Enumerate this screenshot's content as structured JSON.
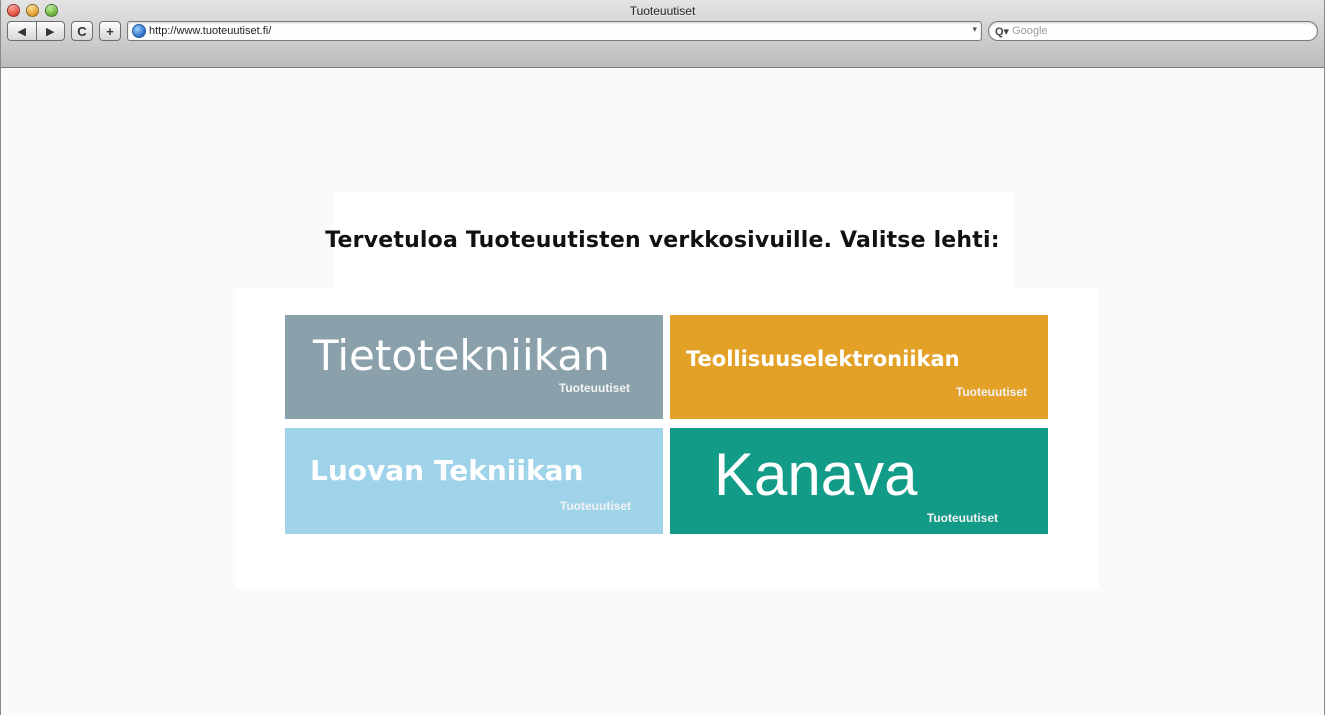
{
  "window": {
    "title": "Tuoteuutiset"
  },
  "toolbar": {
    "back_icon": "◀",
    "forward_icon": "▶",
    "reload_icon": "C",
    "add_icon": "+",
    "url": "http://www.tuoteuutiset.fi/",
    "search_placeholder": "Google",
    "search_icon": "Q▾"
  },
  "page": {
    "welcome": "Tervetuloa Tuoteuutisten verkkosivuille. Valitse lehti:",
    "tiles": [
      {
        "name": "Tietotekniikan",
        "subtitle": "Tuoteuutiset",
        "color": "#8aa1ac"
      },
      {
        "name": "Teollisuuselektroniikan",
        "subtitle": "Tuoteuutiset",
        "color": "#e3a128"
      },
      {
        "name": "Luovan Tekniikan",
        "subtitle": "Tuoteuutiset",
        "color": "#9ed3ea"
      },
      {
        "name": "Kanava",
        "subtitle": "Tuoteuutiset",
        "color": "#129b86"
      }
    ]
  }
}
